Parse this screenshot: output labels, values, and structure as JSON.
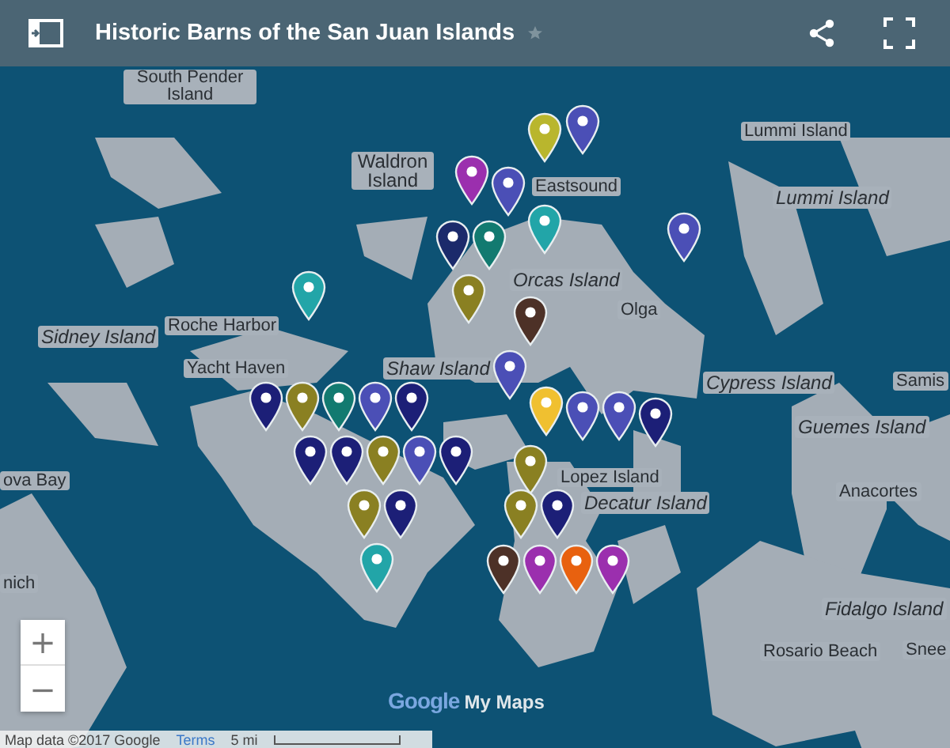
{
  "header": {
    "title": "Historic Barns of the San Juan Islands",
    "starred": false
  },
  "map_labels": [
    {
      "text": "South Pender Island",
      "kind": "place"
    },
    {
      "text": "Waldron Island",
      "kind": "place"
    },
    {
      "text": "Eastsound",
      "kind": "town"
    },
    {
      "text": "Lummi Island",
      "kind": "town"
    },
    {
      "text": "Lummi Island",
      "kind": "island"
    },
    {
      "text": "Orcas Island",
      "kind": "island"
    },
    {
      "text": "Olga",
      "kind": "town"
    },
    {
      "text": "Roche Harbor",
      "kind": "town"
    },
    {
      "text": "Sidney Island",
      "kind": "island"
    },
    {
      "text": "Yacht Haven",
      "kind": "town"
    },
    {
      "text": "Shaw Island",
      "kind": "island"
    },
    {
      "text": "Cypress Island",
      "kind": "island"
    },
    {
      "text": "Samis",
      "kind": "town"
    },
    {
      "text": "Guemes Island",
      "kind": "island"
    },
    {
      "text": "Lopez Island",
      "kind": "town"
    },
    {
      "text": "Decatur Island",
      "kind": "island"
    },
    {
      "text": "Anacortes",
      "kind": "town"
    },
    {
      "text": "Fidalgo Island",
      "kind": "island"
    },
    {
      "text": "Rosario Beach",
      "kind": "town"
    },
    {
      "text": "Snee",
      "kind": "town"
    },
    {
      "text": "ova Bay",
      "kind": "town"
    },
    {
      "text": "nich",
      "kind": "town"
    }
  ],
  "pins": [
    {
      "color": "#b9b62d"
    },
    {
      "color": "#4b4fb6"
    },
    {
      "color": "#9b2fae"
    },
    {
      "color": "#4b4fb6"
    },
    {
      "color": "#22a5a8"
    },
    {
      "color": "#1b2a6b"
    },
    {
      "color": "#127a70"
    },
    {
      "color": "#8a8022"
    },
    {
      "color": "#4b4fb6"
    },
    {
      "color": "#4d3127"
    },
    {
      "color": "#22a5a8"
    },
    {
      "color": "#4b4fb6"
    },
    {
      "color": "#f0c030"
    },
    {
      "color": "#1c1f77"
    },
    {
      "color": "#8a8022"
    },
    {
      "color": "#127a70"
    },
    {
      "color": "#4b4fb6"
    },
    {
      "color": "#8a8022"
    },
    {
      "color": "#1c1f77"
    },
    {
      "color": "#1c1f77"
    },
    {
      "color": "#1c1f77"
    },
    {
      "color": "#4b4fb6"
    },
    {
      "color": "#1c1f77"
    },
    {
      "color": "#8a8022"
    },
    {
      "color": "#1c1f77"
    },
    {
      "color": "#22a5a8"
    },
    {
      "color": "#4b4fb6"
    },
    {
      "color": "#4b4fb6"
    },
    {
      "color": "#1c1f77"
    },
    {
      "color": "#8a8022"
    },
    {
      "color": "#8a8022"
    },
    {
      "color": "#1c1f77"
    },
    {
      "color": "#4d3127"
    },
    {
      "color": "#9b2fae"
    },
    {
      "color": "#e8610f"
    },
    {
      "color": "#9b2fae"
    }
  ],
  "logo": {
    "google": "Google",
    "product": "My Maps"
  },
  "footer": {
    "attribution": "Map data ©2017 Google",
    "terms": "Terms",
    "scale": "5 mi"
  },
  "zoom": {
    "in": "+",
    "out": "−"
  }
}
